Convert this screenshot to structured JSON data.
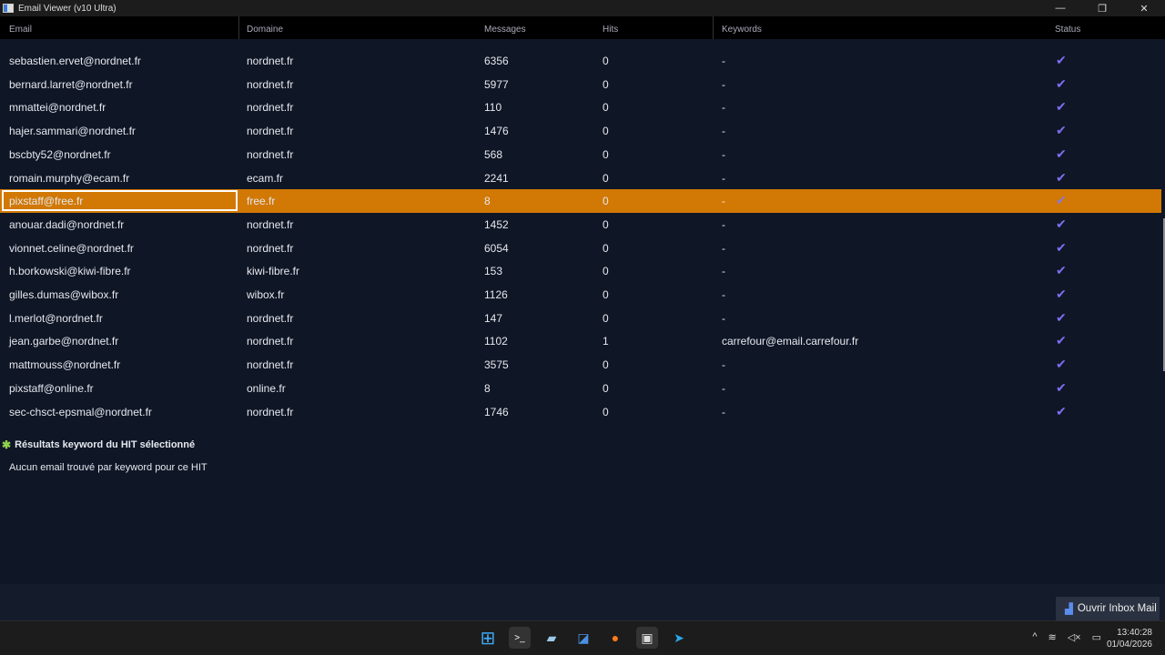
{
  "window": {
    "title": "Email Viewer (v10 Ultra)",
    "minimize": "—",
    "maximize": "❐",
    "close": "✕"
  },
  "columns": [
    "Email",
    "Domaine",
    "Messages",
    "Hits",
    "Keywords",
    "Status"
  ],
  "rows": [
    {
      "email": "sebastien.ervet@nordnet.fr",
      "domain": "nordnet.fr",
      "messages": "6356",
      "hits": "0",
      "keywords": "-"
    },
    {
      "email": "bernard.larret@nordnet.fr",
      "domain": "nordnet.fr",
      "messages": "5977",
      "hits": "0",
      "keywords": "-"
    },
    {
      "email": "mmattei@nordnet.fr",
      "domain": "nordnet.fr",
      "messages": "110",
      "hits": "0",
      "keywords": "-"
    },
    {
      "email": "hajer.sammari@nordnet.fr",
      "domain": "nordnet.fr",
      "messages": "1476",
      "hits": "0",
      "keywords": "-"
    },
    {
      "email": "bscbty52@nordnet.fr",
      "domain": "nordnet.fr",
      "messages": "568",
      "hits": "0",
      "keywords": "-"
    },
    {
      "email": "romain.murphy@ecam.fr",
      "domain": "ecam.fr",
      "messages": "2241",
      "hits": "0",
      "keywords": "-"
    },
    {
      "email": "pixstaff@free.fr",
      "domain": "free.fr",
      "messages": "8",
      "hits": "0",
      "keywords": "-",
      "selected": true
    },
    {
      "email": "anouar.dadi@nordnet.fr",
      "domain": "nordnet.fr",
      "messages": "1452",
      "hits": "0",
      "keywords": "-"
    },
    {
      "email": "vionnet.celine@nordnet.fr",
      "domain": "nordnet.fr",
      "messages": "6054",
      "hits": "0",
      "keywords": "-"
    },
    {
      "email": "h.borkowski@kiwi-fibre.fr",
      "domain": "kiwi-fibre.fr",
      "messages": "153",
      "hits": "0",
      "keywords": "-"
    },
    {
      "email": "gilles.dumas@wibox.fr",
      "domain": "wibox.fr",
      "messages": "1126",
      "hits": "0",
      "keywords": "-"
    },
    {
      "email": "l.merlot@nordnet.fr",
      "domain": "nordnet.fr",
      "messages": "147",
      "hits": "0",
      "keywords": "-"
    },
    {
      "email": "jean.garbe@nordnet.fr",
      "domain": "nordnet.fr",
      "messages": "1102",
      "hits": "1",
      "keywords": "carrefour@email.carrefour.fr"
    },
    {
      "email": "mattmouss@nordnet.fr",
      "domain": "nordnet.fr",
      "messages": "3575",
      "hits": "0",
      "keywords": "-"
    },
    {
      "email": "pixstaff@online.fr",
      "domain": "online.fr",
      "messages": "8",
      "hits": "0",
      "keywords": "-"
    },
    {
      "email": "sec-chsct-epsmal@nordnet.fr",
      "domain": "nordnet.fr",
      "messages": "1746",
      "hits": "0",
      "keywords": "-"
    }
  ],
  "status_icon": "check-icon",
  "panel": {
    "title": "Résultats keyword du HIT sélectionné",
    "empty": "Aucun email trouvé par keyword pour ce HIT"
  },
  "open_button": "Ouvrir Inbox Mail",
  "clock": {
    "time": "13:40:28",
    "date": "01/04/2026"
  },
  "colors": {
    "selected": "#d17805",
    "check": "#7d6ff0",
    "background": "#0f1626"
  }
}
